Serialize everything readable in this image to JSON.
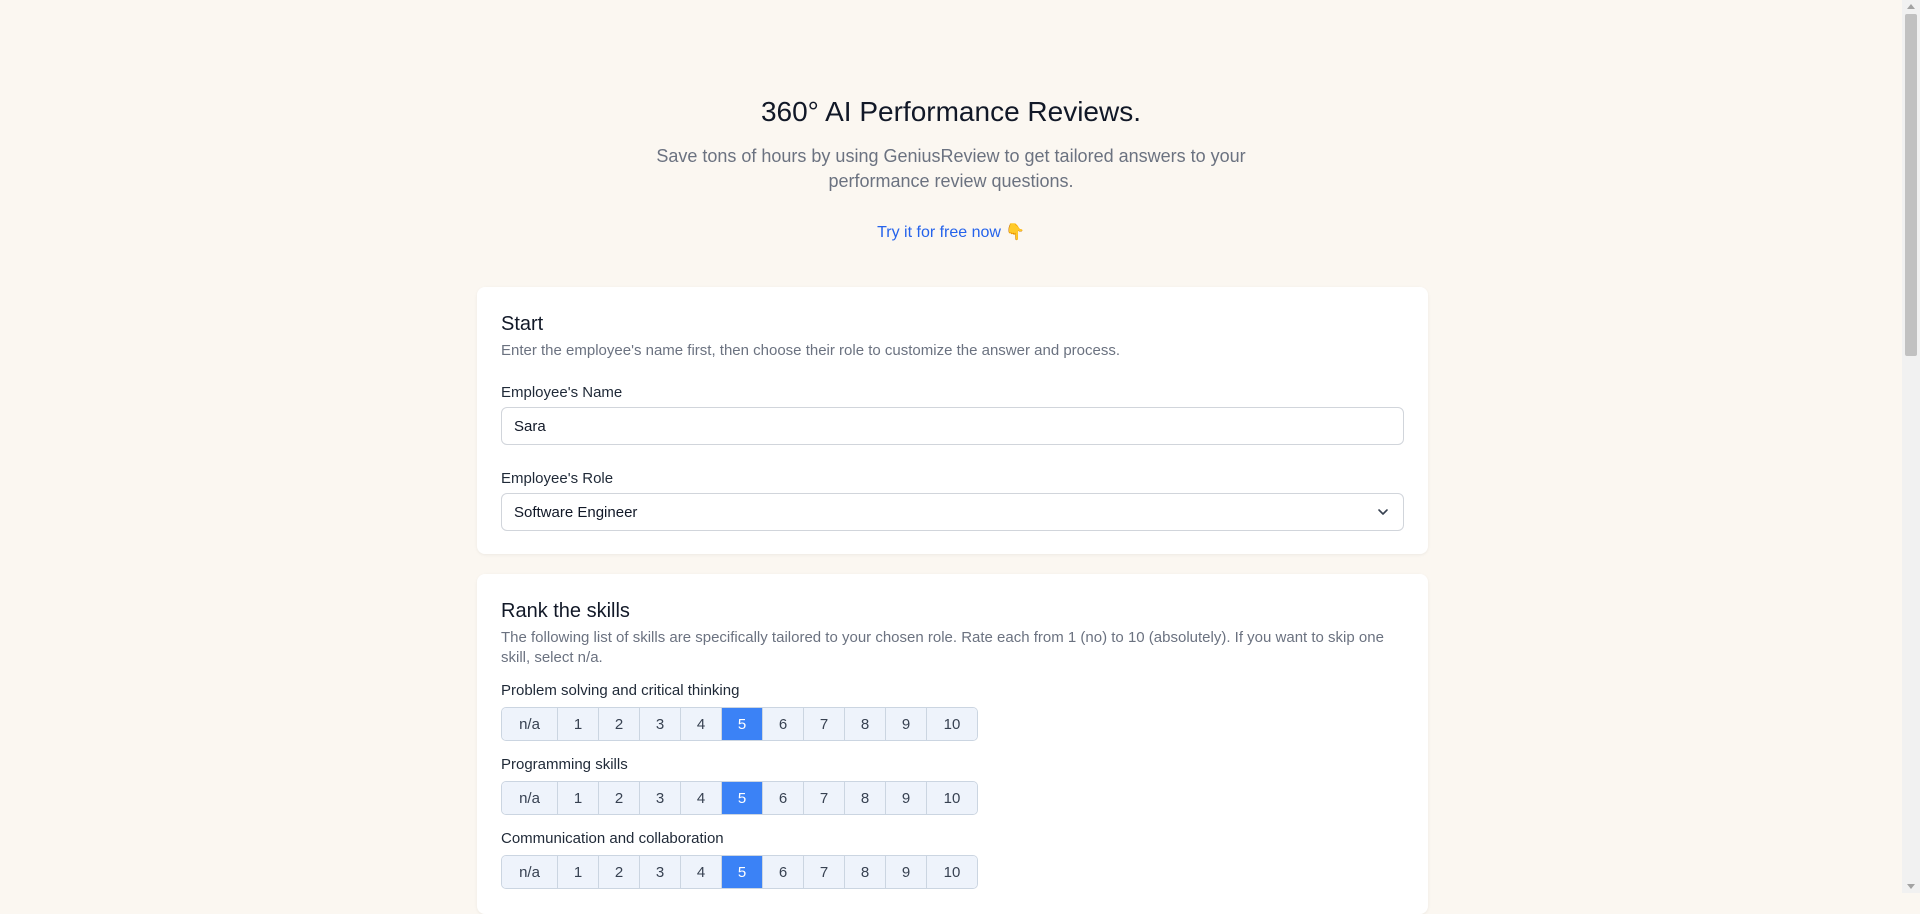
{
  "hero": {
    "title": "360° AI Performance Reviews.",
    "subtitle": "Save tons of hours by using GeniusReview to get tailored answers to your performance review questions.",
    "cta_label": "Try it for free now",
    "cta_emoji": "👇"
  },
  "start": {
    "title": "Start",
    "description": "Enter the employee's name first, then choose their role to customize the answer and process.",
    "name_label": "Employee's Name",
    "name_value": "Sara",
    "role_label": "Employee's Role",
    "role_value": "Software Engineer"
  },
  "skills": {
    "title": "Rank the skills",
    "description": "The following list of skills are specifically tailored to your chosen role. Rate each from 1 (no) to 10 (absolutely). If you want to skip one skill, select n/a.",
    "options": [
      "n/a",
      "1",
      "2",
      "3",
      "4",
      "5",
      "6",
      "7",
      "8",
      "9",
      "10"
    ],
    "items": [
      {
        "label": "Problem solving and critical thinking",
        "selected": "5"
      },
      {
        "label": "Programming skills",
        "selected": "5"
      },
      {
        "label": "Communication and collaboration",
        "selected": "5"
      }
    ]
  },
  "colors": {
    "page_bg": "#fbf7f1",
    "accent": "#3b82f6",
    "link": "#2563eb"
  }
}
